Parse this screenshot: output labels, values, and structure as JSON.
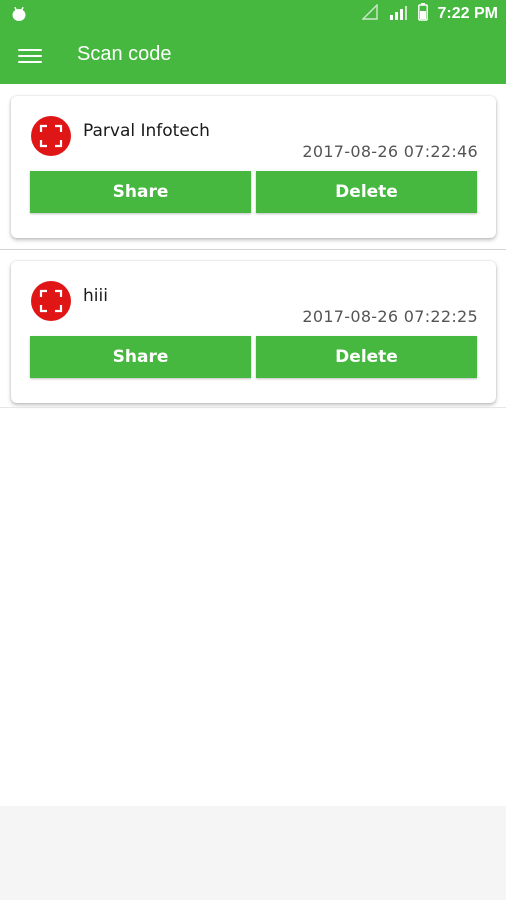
{
  "status_bar": {
    "time": "7:22 PM"
  },
  "app_bar": {
    "title": "Scan code"
  },
  "colors": {
    "primary": "#46b83f",
    "icon_red": "#e01515"
  },
  "items": [
    {
      "name": "Parval Infotech",
      "date": "2017-08-26 07:22:46",
      "share_label": "Share",
      "delete_label": "Delete"
    },
    {
      "name": "hiii",
      "date": "2017-08-26 07:22:25",
      "share_label": "Share",
      "delete_label": "Delete"
    }
  ]
}
